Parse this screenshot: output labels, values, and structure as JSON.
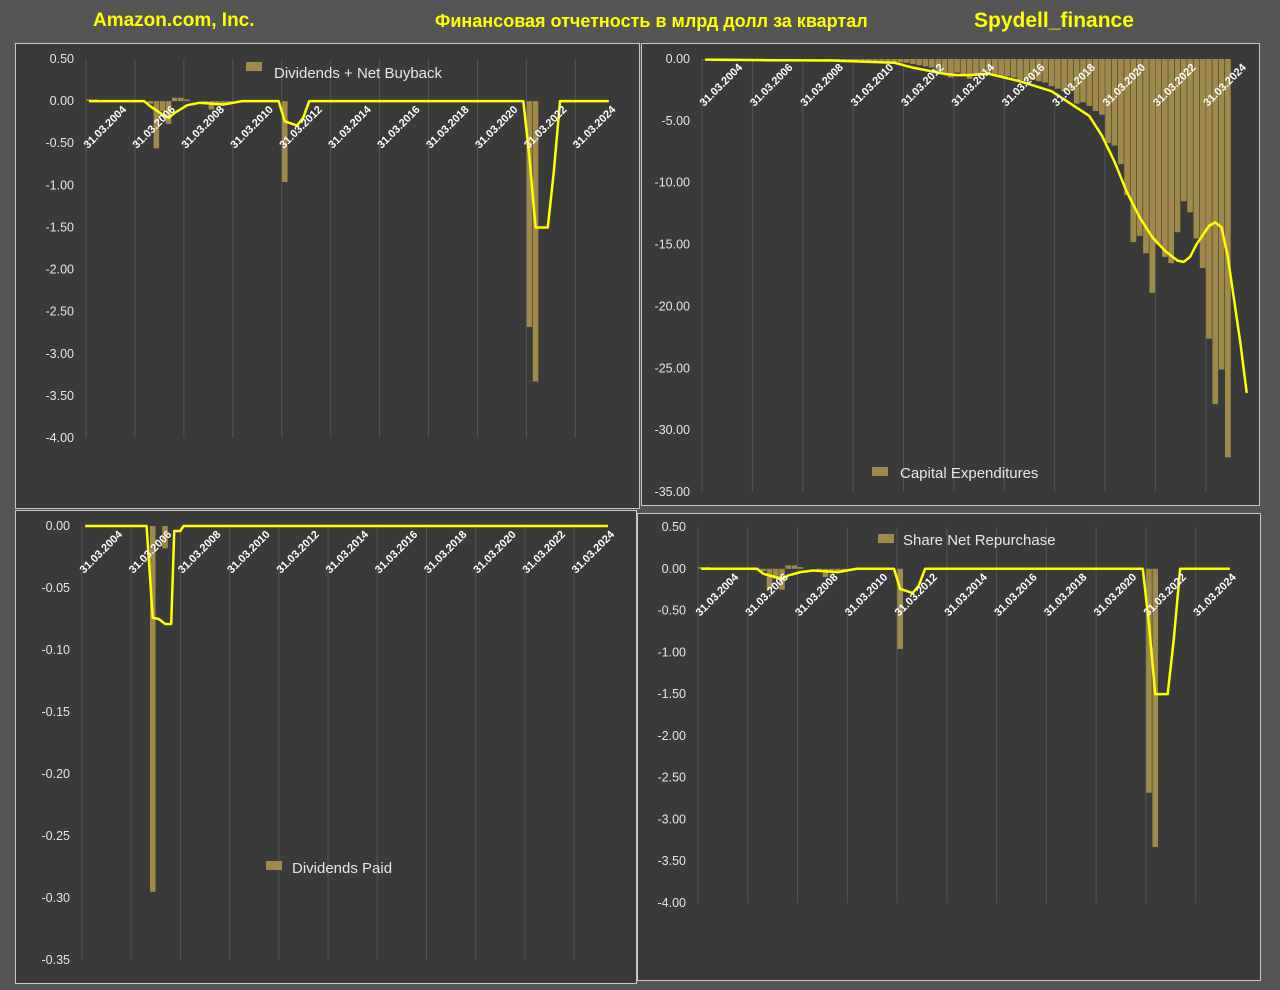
{
  "header": {
    "company": "Amazon.com, Inc.",
    "subtitle": "Финансовая отчетность в млрд долл за квартал",
    "brand": "Spydell_finance"
  },
  "colors": {
    "background": "#555555",
    "panel": "#3a3a3a",
    "bar": "#a08a4a",
    "line": "#ffff00",
    "grid": "#555555"
  },
  "chart_data": [
    {
      "id": "dividends_net_buyback",
      "type": "bar",
      "legend": "Dividends + Net Buyback",
      "legend_position": "top-center",
      "ylim": [
        -4.0,
        0.5
      ],
      "yticks": [
        0.5,
        0.0,
        -0.5,
        -1.0,
        -1.5,
        -2.0,
        -2.5,
        -3.0,
        -3.5,
        -4.0
      ],
      "tick_decimals": 2,
      "x_labels": [
        "31.03.2004",
        "31.03.2006",
        "31.03.2008",
        "31.03.2010",
        "31.03.2012",
        "31.03.2014",
        "31.03.2016",
        "31.03.2018",
        "31.03.2020",
        "31.03.2022",
        "31.03.2024"
      ],
      "x_start": "2004-03-31",
      "quarters": 86,
      "series": [
        {
          "type": "bar",
          "values": [
            {
              "q": 0,
              "v": 0.02
            },
            {
              "q": 1,
              "v": 0.02
            },
            {
              "q": 2,
              "v": 0.01
            },
            {
              "q": 10,
              "v": -0.03
            },
            {
              "q": 11,
              "v": -0.56
            },
            {
              "q": 12,
              "v": -0.12
            },
            {
              "q": 13,
              "v": -0.27
            },
            {
              "q": 14,
              "v": 0.04
            },
            {
              "q": 15,
              "v": 0.04
            },
            {
              "q": 16,
              "v": 0.02
            },
            {
              "q": 19,
              "v": -0.03
            },
            {
              "q": 20,
              "v": -0.1
            },
            {
              "q": 21,
              "v": -0.05
            },
            {
              "q": 22,
              "v": -0.03
            },
            {
              "q": 23,
              "v": -0.02
            },
            {
              "q": 32,
              "v": -0.96
            },
            {
              "q": 72,
              "v": -2.68
            },
            {
              "q": 73,
              "v": -3.33
            }
          ]
        },
        {
          "type": "line",
          "values": [
            {
              "q": 0,
              "v": 0.0
            },
            {
              "q": 9,
              "v": 0.0
            },
            {
              "q": 10,
              "v": -0.06
            },
            {
              "q": 12,
              "v": -0.16
            },
            {
              "q": 13,
              "v": -0.2
            },
            {
              "q": 14,
              "v": -0.14
            },
            {
              "q": 16,
              "v": -0.05
            },
            {
              "q": 18,
              "v": -0.02
            },
            {
              "q": 22,
              "v": -0.04
            },
            {
              "q": 25,
              "v": 0.0
            },
            {
              "q": 31,
              "v": 0.0
            },
            {
              "q": 32,
              "v": -0.24
            },
            {
              "q": 34,
              "v": -0.29
            },
            {
              "q": 35,
              "v": -0.2
            },
            {
              "q": 36,
              "v": 0.0
            },
            {
              "q": 71,
              "v": 0.0
            },
            {
              "q": 72,
              "v": -0.67
            },
            {
              "q": 73,
              "v": -1.5
            },
            {
              "q": 75,
              "v": -1.5
            },
            {
              "q": 76,
              "v": -0.83
            },
            {
              "q": 77,
              "v": 0.0
            },
            {
              "q": 85,
              "v": 0.0
            }
          ]
        }
      ]
    },
    {
      "id": "capital_expenditures",
      "type": "bar",
      "legend": "Capital Expenditures",
      "legend_position": "bottom-center",
      "ylim": [
        -35.0,
        0.0
      ],
      "yticks": [
        0.0,
        -5.0,
        -10.0,
        -15.0,
        -20.0,
        -25.0,
        -30.0,
        -35.0
      ],
      "tick_decimals": 2,
      "x_labels": [
        "31.03.2004",
        "31.03.2006",
        "31.03.2008",
        "31.03.2010",
        "31.03.2012",
        "31.03.2014",
        "31.03.2016",
        "31.03.2018",
        "31.03.2020",
        "31.03.2022",
        "31.03.2024"
      ],
      "x_start": "2004-03-31",
      "quarters": 84,
      "series": [
        {
          "type": "bar",
          "values": [
            -0.04,
            -0.05,
            -0.05,
            -0.06,
            -0.06,
            -0.07,
            -0.08,
            -0.09,
            -0.08,
            -0.08,
            -0.1,
            -0.1,
            -0.1,
            -0.11,
            -0.12,
            -0.12,
            -0.1,
            -0.08,
            -0.09,
            -0.1,
            -0.1,
            -0.11,
            -0.12,
            -0.13,
            -0.13,
            -0.14,
            -0.15,
            -0.17,
            -0.2,
            -0.22,
            -0.25,
            -0.28,
            -0.3,
            -0.4,
            -0.5,
            -0.6,
            -0.7,
            -1.0,
            -1.2,
            -1.5,
            -1.1,
            -1.3,
            -1.6,
            -1.3,
            -1.1,
            -1.2,
            -1.3,
            -1.4,
            -1.4,
            -1.5,
            -1.7,
            -1.8,
            -1.7,
            -1.8,
            -1.9,
            -2.2,
            -2.4,
            -2.6,
            -2.5,
            -3.6,
            -3.5,
            -3.8,
            -4.2,
            -4.5,
            -6.8,
            -7.0,
            -8.5,
            -11.0,
            -14.8,
            -14.3,
            -15.7,
            -18.9,
            -15.0,
            -16.0,
            -16.5,
            -14.0,
            -11.5,
            -12.4,
            -14.5,
            -16.9,
            -22.6,
            -27.9,
            -25.1,
            -32.2
          ]
        },
        {
          "type": "line",
          "values": [
            {
              "q": 0,
              "v": -0.05
            },
            {
              "q": 10,
              "v": -0.1
            },
            {
              "q": 20,
              "v": -0.12
            },
            {
              "q": 30,
              "v": -0.3
            },
            {
              "q": 33,
              "v": -0.7
            },
            {
              "q": 36,
              "v": -1.0
            },
            {
              "q": 38,
              "v": -1.2
            },
            {
              "q": 40,
              "v": -1.3
            },
            {
              "q": 42,
              "v": -1.3
            },
            {
              "q": 45,
              "v": -1.2
            },
            {
              "q": 50,
              "v": -1.8
            },
            {
              "q": 55,
              "v": -2.6
            },
            {
              "q": 58,
              "v": -3.6
            },
            {
              "q": 61,
              "v": -4.6
            },
            {
              "q": 63,
              "v": -6.2
            },
            {
              "q": 65,
              "v": -8.3
            },
            {
              "q": 67,
              "v": -10.8
            },
            {
              "q": 69,
              "v": -12.8
            },
            {
              "q": 71,
              "v": -14.4
            },
            {
              "q": 73,
              "v": -15.5
            },
            {
              "q": 75,
              "v": -16.3
            },
            {
              "q": 76,
              "v": -16.4
            },
            {
              "q": 77,
              "v": -16.0
            },
            {
              "q": 78,
              "v": -15.0
            },
            {
              "q": 80,
              "v": -13.5
            },
            {
              "q": 81,
              "v": -13.2
            },
            {
              "q": 82,
              "v": -13.6
            },
            {
              "q": 83,
              "v": -16.0
            },
            {
              "q": 84,
              "v": -19.5
            },
            {
              "q": 85,
              "v": -23.0
            },
            {
              "q": 86,
              "v": -27.0
            }
          ]
        }
      ]
    },
    {
      "id": "dividends_paid",
      "type": "bar",
      "legend": "Dividends Paid",
      "legend_position": "center",
      "ylim": [
        -0.35,
        0.0
      ],
      "yticks": [
        0.0,
        -0.05,
        -0.1,
        -0.15,
        -0.2,
        -0.25,
        -0.3,
        -0.35
      ],
      "tick_decimals": 2,
      "x_labels": [
        "31.03.2004",
        "31.03.2006",
        "31.03.2008",
        "31.03.2010",
        "31.03.2012",
        "31.03.2014",
        "31.03.2016",
        "31.03.2018",
        "31.03.2020",
        "31.03.2022",
        "31.03.2024"
      ],
      "x_start": "2004-03-31",
      "quarters": 86,
      "series": [
        {
          "type": "bar",
          "values": [
            {
              "q": 11,
              "v": -0.295
            },
            {
              "q": 13,
              "v": -0.018
            }
          ]
        },
        {
          "type": "line",
          "values": [
            {
              "q": 0,
              "v": 0.0
            },
            {
              "q": 10,
              "v": 0.0
            },
            {
              "q": 11,
              "v": -0.074
            },
            {
              "q": 12,
              "v": -0.075
            },
            {
              "q": 13,
              "v": -0.079
            },
            {
              "q": 14,
              "v": -0.079
            },
            {
              "q": 14.5,
              "v": -0.004
            },
            {
              "q": 15.5,
              "v": -0.004
            },
            {
              "q": 16,
              "v": 0.0
            },
            {
              "q": 85,
              "v": 0.0
            }
          ]
        }
      ]
    },
    {
      "id": "share_net_repurchase",
      "type": "bar",
      "legend": "Share Net Repurchase",
      "legend_position": "top-center",
      "ylim": [
        -4.0,
        0.5
      ],
      "yticks": [
        0.5,
        0.0,
        -0.5,
        -1.0,
        -1.5,
        -2.0,
        -2.5,
        -3.0,
        -3.5,
        -4.0
      ],
      "tick_decimals": 2,
      "x_labels": [
        "31.03.2004",
        "31.03.2006",
        "31.03.2008",
        "31.03.2010",
        "31.03.2012",
        "31.03.2014",
        "31.03.2016",
        "31.03.2018",
        "31.03.2020",
        "31.03.2022",
        "31.03.2024"
      ],
      "x_start": "2004-03-31",
      "quarters": 86,
      "series": [
        {
          "type": "bar",
          "values": [
            {
              "q": 0,
              "v": 0.02
            },
            {
              "q": 1,
              "v": 0.02
            },
            {
              "q": 2,
              "v": 0.01
            },
            {
              "q": 10,
              "v": -0.03
            },
            {
              "q": 11,
              "v": -0.25
            },
            {
              "q": 12,
              "v": -0.12
            },
            {
              "q": 13,
              "v": -0.25
            },
            {
              "q": 14,
              "v": 0.04
            },
            {
              "q": 15,
              "v": 0.04
            },
            {
              "q": 16,
              "v": 0.02
            },
            {
              "q": 19,
              "v": -0.03
            },
            {
              "q": 20,
              "v": -0.1
            },
            {
              "q": 21,
              "v": -0.05
            },
            {
              "q": 22,
              "v": -0.03
            },
            {
              "q": 23,
              "v": -0.02
            },
            {
              "q": 32,
              "v": -0.96
            },
            {
              "q": 72,
              "v": -2.68
            },
            {
              "q": 73,
              "v": -3.33
            }
          ]
        },
        {
          "type": "line",
          "values": [
            {
              "q": 0,
              "v": 0.0
            },
            {
              "q": 9,
              "v": 0.0
            },
            {
              "q": 10,
              "v": -0.06
            },
            {
              "q": 12,
              "v": -0.1
            },
            {
              "q": 13,
              "v": -0.12
            },
            {
              "q": 14,
              "v": -0.08
            },
            {
              "q": 16,
              "v": -0.04
            },
            {
              "q": 18,
              "v": -0.02
            },
            {
              "q": 22,
              "v": -0.04
            },
            {
              "q": 25,
              "v": 0.0
            },
            {
              "q": 31,
              "v": 0.0
            },
            {
              "q": 32,
              "v": -0.24
            },
            {
              "q": 34,
              "v": -0.29
            },
            {
              "q": 35,
              "v": -0.2
            },
            {
              "q": 36,
              "v": 0.0
            },
            {
              "q": 71,
              "v": 0.0
            },
            {
              "q": 72,
              "v": -0.67
            },
            {
              "q": 73,
              "v": -1.5
            },
            {
              "q": 75,
              "v": -1.5
            },
            {
              "q": 76,
              "v": -0.83
            },
            {
              "q": 77,
              "v": 0.0
            },
            {
              "q": 85,
              "v": 0.0
            }
          ]
        }
      ]
    }
  ]
}
